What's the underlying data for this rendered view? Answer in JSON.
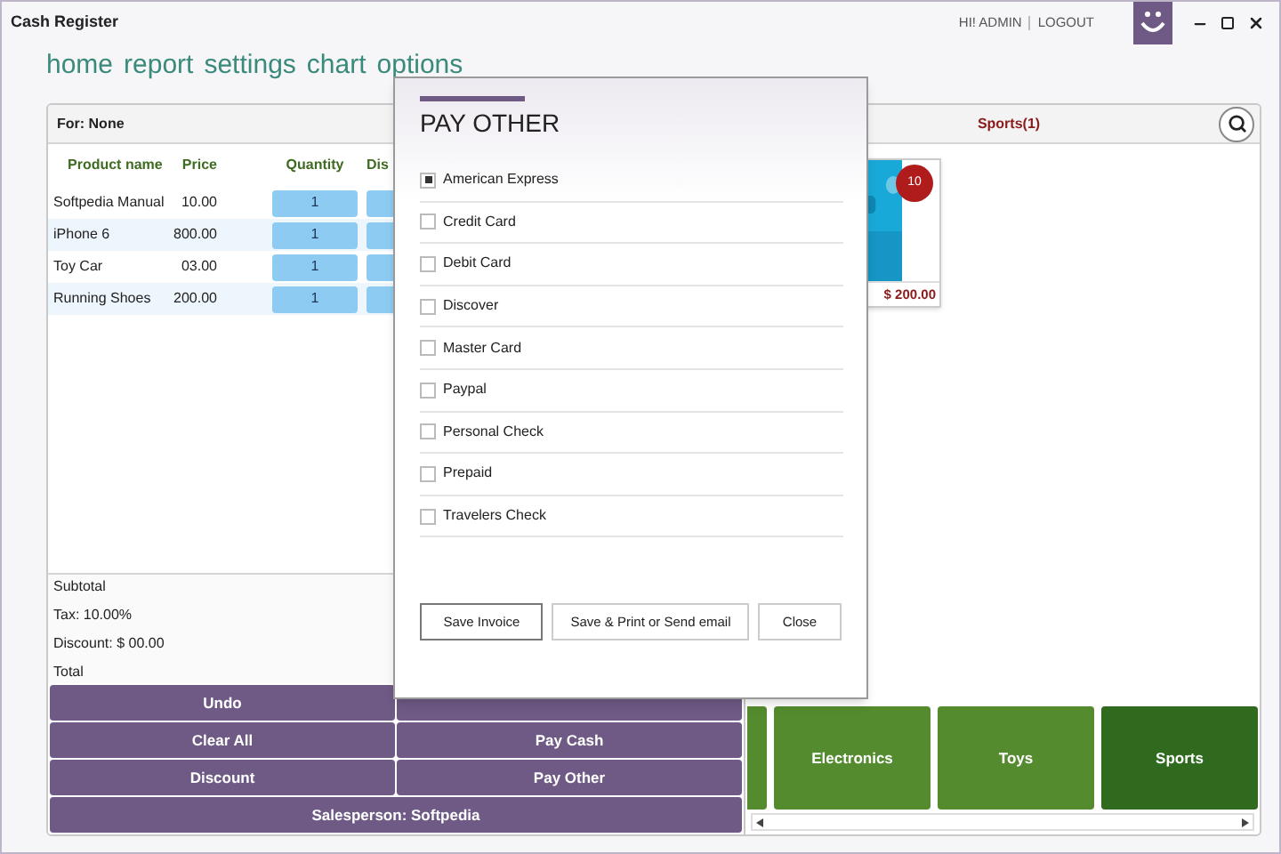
{
  "window": {
    "title": "Cash Register"
  },
  "user": {
    "greeting": "HI! ADMIN",
    "logout": "LOGOUT"
  },
  "nav": [
    "home",
    "report",
    "settings",
    "chart",
    "options"
  ],
  "order": {
    "for": "For: None",
    "columns": [
      "Product name",
      "Price",
      "Quantity",
      "Dis"
    ],
    "rows": [
      {
        "name": "Softpedia Manual",
        "price": "10.00",
        "quantity": "1"
      },
      {
        "name": "iPhone 6",
        "price": "800.00",
        "quantity": "1"
      },
      {
        "name": "Toy Car",
        "price": "03.00",
        "quantity": "1"
      },
      {
        "name": "Running Shoes",
        "price": "200.00",
        "quantity": "1"
      }
    ],
    "totals": [
      "Subtotal",
      "Tax: 10.00%",
      "Discount: $ 00.00",
      "Total"
    ],
    "actions": [
      {
        "kind": "labeled",
        "label": "Undo"
      },
      {
        "kind": "covered"
      },
      {
        "kind": "labeled",
        "label": "Clear All"
      },
      {
        "kind": "labeled",
        "label": "Pay Cash"
      },
      {
        "kind": "labeled",
        "label": "Discount"
      },
      {
        "kind": "labeled",
        "label": "Pay Other"
      }
    ],
    "salesperson": "Salesperson: Softpedia"
  },
  "products": {
    "header": "Sports(1)",
    "items": [
      {
        "badge": "10",
        "price": "$ 200.00"
      }
    ]
  },
  "categories": [
    {
      "label": "Electronics",
      "selected": false
    },
    {
      "label": "Toys",
      "selected": false
    },
    {
      "label": "Sports",
      "selected": true
    }
  ],
  "dialog": {
    "title": "PAY OTHER",
    "options": [
      {
        "label": "American Express",
        "checked": true
      },
      {
        "label": "Credit Card",
        "checked": false
      },
      {
        "label": "Debit Card",
        "checked": false
      },
      {
        "label": "Discover",
        "checked": false
      },
      {
        "label": "Master Card",
        "checked": false
      },
      {
        "label": "Paypal",
        "checked": false
      },
      {
        "label": "Personal Check",
        "checked": false
      },
      {
        "label": "Prepaid",
        "checked": false
      },
      {
        "label": "Travelers Check",
        "checked": false
      }
    ],
    "buttons": [
      "Save Invoice",
      "Save & Print or Send email",
      "Close"
    ]
  }
}
